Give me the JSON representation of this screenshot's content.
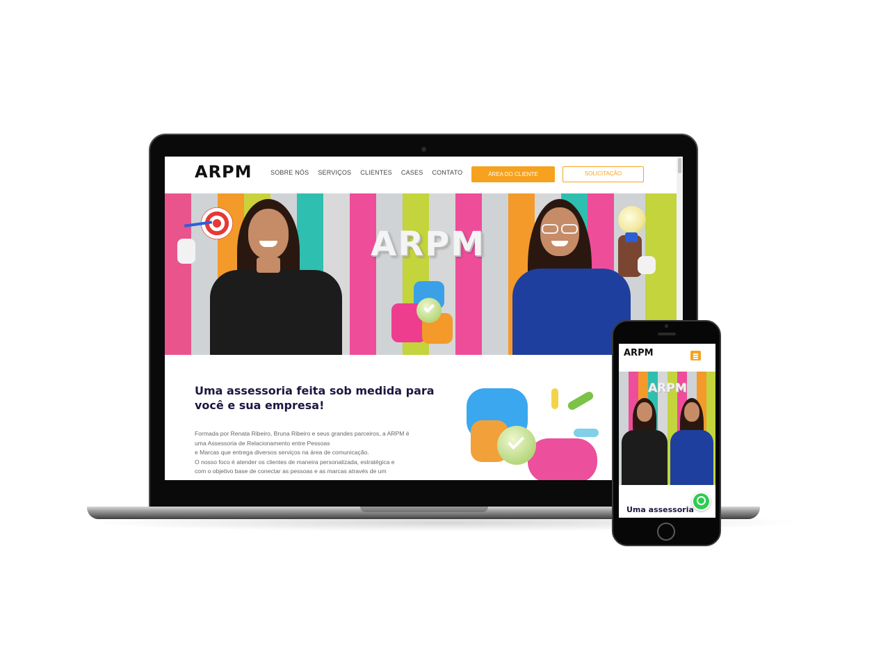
{
  "desktop": {
    "brand": "ARPM",
    "nav": [
      "SOBRE NÓS",
      "SERVIÇOS",
      "CLIENTES",
      "CASES",
      "CONTATO"
    ],
    "cta_primary": "ÁREA DO CLIENTE",
    "cta_secondary": "SOLICITAÇÃO",
    "hero_logo": "ARPM",
    "headline_line1": "Uma assessoria feita sob medida para",
    "headline_line2": "você e sua empresa!",
    "paragraph_lines": [
      "Formada por Renata Ribeiro, Bruna Ribeiro e seus grandes parceiros, a ARPM é",
      "uma Assessoria de Relacionamento entre Pessoas",
      "e Marcas que entrega diversos serviços na área de comunicação.",
      "O nosso foco é atender os clientes de maneira personalizada, estratégica e",
      "com o objetivo base de conectar as pessoas e as marcas através de um"
    ]
  },
  "mobile": {
    "brand": "ARPM",
    "hero_logo": "ARPM",
    "headline": "Uma assessoria"
  },
  "icons": {
    "menu": "hamburger-menu-icon",
    "chat": "whatsapp-icon"
  },
  "colors": {
    "accent": "#f6a21e",
    "headline": "#1b1740",
    "whatsapp": "#2ecc55"
  }
}
